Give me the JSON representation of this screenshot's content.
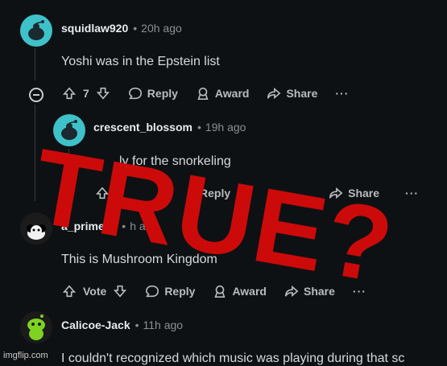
{
  "overlay_text": "TRUE?",
  "watermark": "imgflip.com",
  "comments": [
    {
      "username": "squidlaw920",
      "time": "20h ago",
      "body": "Yoshi was in the Epstein list",
      "vote_count": "7",
      "reply_label": "Reply",
      "award_label": "Award",
      "share_label": "Share",
      "more_label": "···"
    },
    {
      "username": "crescent_blossom",
      "time": "19h ago",
      "body_visible": "ly for the snorkeling",
      "reply_label": "Reply",
      "share_label": "Share",
      "more_label": "···"
    },
    {
      "username": "a_prime98",
      "time": "h a",
      "body": "This is Mushroom Kingdom",
      "vote_label": "Vote",
      "reply_label": "Reply",
      "award_label": "Award",
      "share_label": "Share",
      "more_label": "···"
    },
    {
      "username": "Calicoe-Jack",
      "time": "11h ago",
      "body": "I couldn't recognized which music was playing during that sc"
    }
  ],
  "colors": {
    "background": "#0e1113",
    "overlay": "#cc0a0a",
    "avatar_teal": "#3fc1c9",
    "avatar_green": "#7ed321"
  }
}
